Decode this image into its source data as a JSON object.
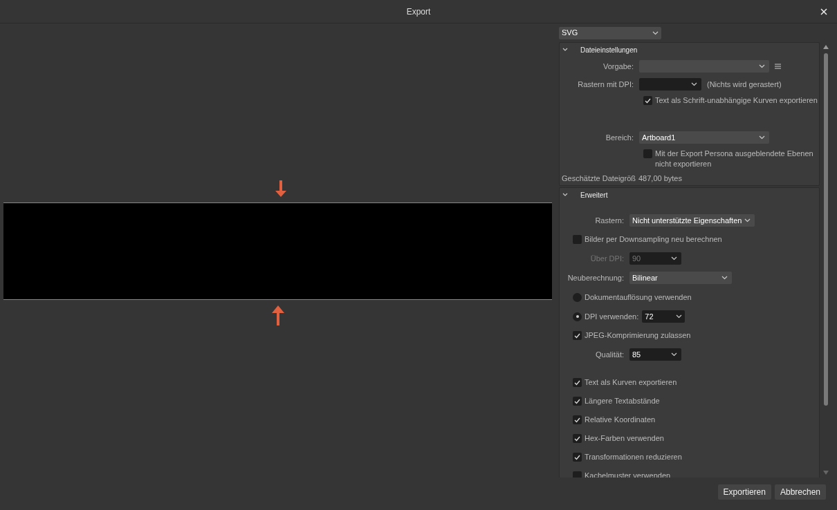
{
  "window": {
    "title": "Export"
  },
  "format_select": {
    "value": "SVG"
  },
  "sections": [
    {
      "title": "Dateieinstellungen",
      "expanded": true,
      "groups": [
        [
          {
            "kind": "dropdown",
            "label": "Vorgabe:",
            "menu": true
          },
          {
            "kind": "dropdown",
            "label": "Rastern mit DPI:",
            "dark": true,
            "note": "(Nichts wird gerastert)"
          },
          {
            "kind": "checkbox",
            "label": "Text als Schrift-unabhängige Kurven exportieren",
            "checked": true
          }
        ],
        [
          {
            "kind": "dropdown",
            "label": "Bereich:",
            "value": "Artboard1"
          },
          {
            "kind": "checkbox",
            "label": "Mit der Export Persona ausgeblendete Ebenen nicht exportieren",
            "checked": false
          },
          {
            "kind": "text",
            "label": "Geschätzte Dateigröß",
            "value": "487,00 bytes"
          }
        ]
      ]
    },
    {
      "title": "Erweitert",
      "expanded": true,
      "groups": [
        [
          {
            "kind": "dropdown",
            "label": "Rastern:",
            "value": "Nicht unterstützte Eigenschaften"
          },
          {
            "kind": "checkbox",
            "label": "Bilder per Downsampling neu berechnen",
            "checked": false
          },
          {
            "kind": "dropdown",
            "label": "Über DPI:",
            "value": "90",
            "disabled": true,
            "dark": true
          },
          {
            "kind": "dropdown",
            "label": "Neuberechnung:",
            "value": "Bilinear"
          },
          {
            "kind": "radio",
            "label": "Dokumentauflösung verwenden",
            "selected": false
          },
          {
            "kind": "radio",
            "label": "DPI verwenden:",
            "selected": true,
            "value": "72"
          },
          {
            "kind": "checkbox",
            "label": "JPEG-Komprimierung zulassen",
            "checked": true
          },
          {
            "kind": "dropdown",
            "label": "Qualität:",
            "value": "85",
            "dark": true
          }
        ],
        [
          {
            "kind": "checkbox",
            "label": "Text als Kurven exportieren",
            "checked": true
          },
          {
            "kind": "checkbox",
            "label": "Längere Textabstände",
            "checked": true
          },
          {
            "kind": "checkbox",
            "label": "Relative Koordinaten",
            "checked": true
          },
          {
            "kind": "checkbox",
            "label": "Hex-Farben verwenden",
            "checked": true
          },
          {
            "kind": "checkbox",
            "label": "Transformationen reduzieren",
            "checked": true
          },
          {
            "kind": "checkbox",
            "label": "Kachelmuster verwenden",
            "checked": false
          }
        ]
      ]
    }
  ],
  "buttons": [
    {
      "label": "Exportieren"
    },
    {
      "label": "Abbrechen"
    }
  ]
}
